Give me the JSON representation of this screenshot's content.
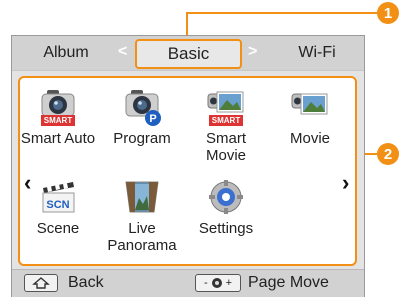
{
  "callouts": {
    "one": "1",
    "two": "2"
  },
  "tabs": {
    "left": "Album",
    "current": "Basic",
    "right": "Wi-Fi"
  },
  "modes": [
    {
      "label": "Smart Auto",
      "icon": "smart-auto-camera-icon",
      "tag": "SMART"
    },
    {
      "label": "Program",
      "icon": "program-camera-icon",
      "badge": "P"
    },
    {
      "label": "Smart Movie",
      "icon": "smart-movie-icon",
      "tag": "SMART"
    },
    {
      "label": "Movie",
      "icon": "movie-camera-icon"
    },
    {
      "label": "Scene",
      "icon": "scene-clapper-icon",
      "tag": "SCN"
    },
    {
      "label": "Live Panorama",
      "icon": "live-panorama-icon"
    },
    {
      "label": "Settings",
      "icon": "settings-gear-icon"
    }
  ],
  "bottom": {
    "back_label": "Back",
    "page_move_label": "Page Move",
    "dial_minus": "-",
    "dial_plus": "+"
  },
  "colors": {
    "accent": "#f29016",
    "tag_red": "#d33333",
    "program_badge": "#1f5fbf"
  }
}
